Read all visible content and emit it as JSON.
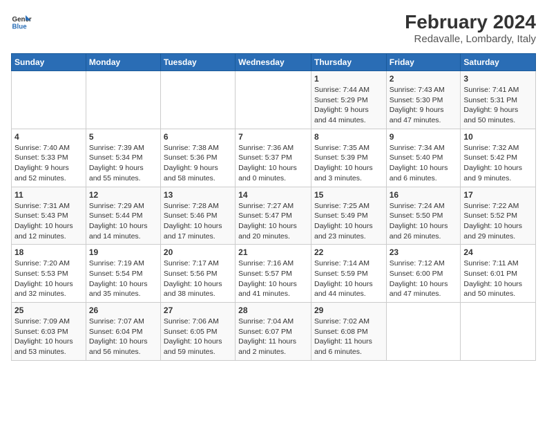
{
  "header": {
    "logo_line1": "General",
    "logo_line2": "Blue",
    "title": "February 2024",
    "subtitle": "Redavalle, Lombardy, Italy"
  },
  "days_of_week": [
    "Sunday",
    "Monday",
    "Tuesday",
    "Wednesday",
    "Thursday",
    "Friday",
    "Saturday"
  ],
  "weeks": [
    [
      {
        "day": "",
        "detail": ""
      },
      {
        "day": "",
        "detail": ""
      },
      {
        "day": "",
        "detail": ""
      },
      {
        "day": "",
        "detail": ""
      },
      {
        "day": "1",
        "detail": "Sunrise: 7:44 AM\nSunset: 5:29 PM\nDaylight: 9 hours\nand 44 minutes."
      },
      {
        "day": "2",
        "detail": "Sunrise: 7:43 AM\nSunset: 5:30 PM\nDaylight: 9 hours\nand 47 minutes."
      },
      {
        "day": "3",
        "detail": "Sunrise: 7:41 AM\nSunset: 5:31 PM\nDaylight: 9 hours\nand 50 minutes."
      }
    ],
    [
      {
        "day": "4",
        "detail": "Sunrise: 7:40 AM\nSunset: 5:33 PM\nDaylight: 9 hours\nand 52 minutes."
      },
      {
        "day": "5",
        "detail": "Sunrise: 7:39 AM\nSunset: 5:34 PM\nDaylight: 9 hours\nand 55 minutes."
      },
      {
        "day": "6",
        "detail": "Sunrise: 7:38 AM\nSunset: 5:36 PM\nDaylight: 9 hours\nand 58 minutes."
      },
      {
        "day": "7",
        "detail": "Sunrise: 7:36 AM\nSunset: 5:37 PM\nDaylight: 10 hours\nand 0 minutes."
      },
      {
        "day": "8",
        "detail": "Sunrise: 7:35 AM\nSunset: 5:39 PM\nDaylight: 10 hours\nand 3 minutes."
      },
      {
        "day": "9",
        "detail": "Sunrise: 7:34 AM\nSunset: 5:40 PM\nDaylight: 10 hours\nand 6 minutes."
      },
      {
        "day": "10",
        "detail": "Sunrise: 7:32 AM\nSunset: 5:42 PM\nDaylight: 10 hours\nand 9 minutes."
      }
    ],
    [
      {
        "day": "11",
        "detail": "Sunrise: 7:31 AM\nSunset: 5:43 PM\nDaylight: 10 hours\nand 12 minutes."
      },
      {
        "day": "12",
        "detail": "Sunrise: 7:29 AM\nSunset: 5:44 PM\nDaylight: 10 hours\nand 14 minutes."
      },
      {
        "day": "13",
        "detail": "Sunrise: 7:28 AM\nSunset: 5:46 PM\nDaylight: 10 hours\nand 17 minutes."
      },
      {
        "day": "14",
        "detail": "Sunrise: 7:27 AM\nSunset: 5:47 PM\nDaylight: 10 hours\nand 20 minutes."
      },
      {
        "day": "15",
        "detail": "Sunrise: 7:25 AM\nSunset: 5:49 PM\nDaylight: 10 hours\nand 23 minutes."
      },
      {
        "day": "16",
        "detail": "Sunrise: 7:24 AM\nSunset: 5:50 PM\nDaylight: 10 hours\nand 26 minutes."
      },
      {
        "day": "17",
        "detail": "Sunrise: 7:22 AM\nSunset: 5:52 PM\nDaylight: 10 hours\nand 29 minutes."
      }
    ],
    [
      {
        "day": "18",
        "detail": "Sunrise: 7:20 AM\nSunset: 5:53 PM\nDaylight: 10 hours\nand 32 minutes."
      },
      {
        "day": "19",
        "detail": "Sunrise: 7:19 AM\nSunset: 5:54 PM\nDaylight: 10 hours\nand 35 minutes."
      },
      {
        "day": "20",
        "detail": "Sunrise: 7:17 AM\nSunset: 5:56 PM\nDaylight: 10 hours\nand 38 minutes."
      },
      {
        "day": "21",
        "detail": "Sunrise: 7:16 AM\nSunset: 5:57 PM\nDaylight: 10 hours\nand 41 minutes."
      },
      {
        "day": "22",
        "detail": "Sunrise: 7:14 AM\nSunset: 5:59 PM\nDaylight: 10 hours\nand 44 minutes."
      },
      {
        "day": "23",
        "detail": "Sunrise: 7:12 AM\nSunset: 6:00 PM\nDaylight: 10 hours\nand 47 minutes."
      },
      {
        "day": "24",
        "detail": "Sunrise: 7:11 AM\nSunset: 6:01 PM\nDaylight: 10 hours\nand 50 minutes."
      }
    ],
    [
      {
        "day": "25",
        "detail": "Sunrise: 7:09 AM\nSunset: 6:03 PM\nDaylight: 10 hours\nand 53 minutes."
      },
      {
        "day": "26",
        "detail": "Sunrise: 7:07 AM\nSunset: 6:04 PM\nDaylight: 10 hours\nand 56 minutes."
      },
      {
        "day": "27",
        "detail": "Sunrise: 7:06 AM\nSunset: 6:05 PM\nDaylight: 10 hours\nand 59 minutes."
      },
      {
        "day": "28",
        "detail": "Sunrise: 7:04 AM\nSunset: 6:07 PM\nDaylight: 11 hours\nand 2 minutes."
      },
      {
        "day": "29",
        "detail": "Sunrise: 7:02 AM\nSunset: 6:08 PM\nDaylight: 11 hours\nand 6 minutes."
      },
      {
        "day": "",
        "detail": ""
      },
      {
        "day": "",
        "detail": ""
      }
    ]
  ]
}
